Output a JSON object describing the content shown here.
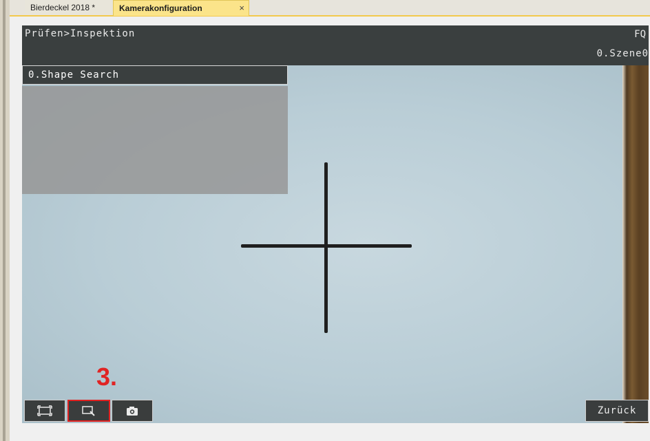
{
  "tabs": [
    {
      "label": "Bierdeckel 2018 *"
    },
    {
      "label": "Kamerakonfiguration",
      "close": "×"
    }
  ],
  "viewer": {
    "breadcrumb": "Prüfen>Inspektion",
    "right_top": "FQ",
    "right_scene": "0.Szene0"
  },
  "shape_search": {
    "title": "0.Shape Search"
  },
  "toolbar": {
    "fit_icon": "fit-frame-icon",
    "tool_icon": "magnifier-tool-icon",
    "camera_icon": "camera-icon",
    "back_label": "Zurück"
  },
  "annotation": {
    "step": "3."
  },
  "colors": {
    "highlight": "#e02020",
    "active_tab": "#fbe48a"
  }
}
